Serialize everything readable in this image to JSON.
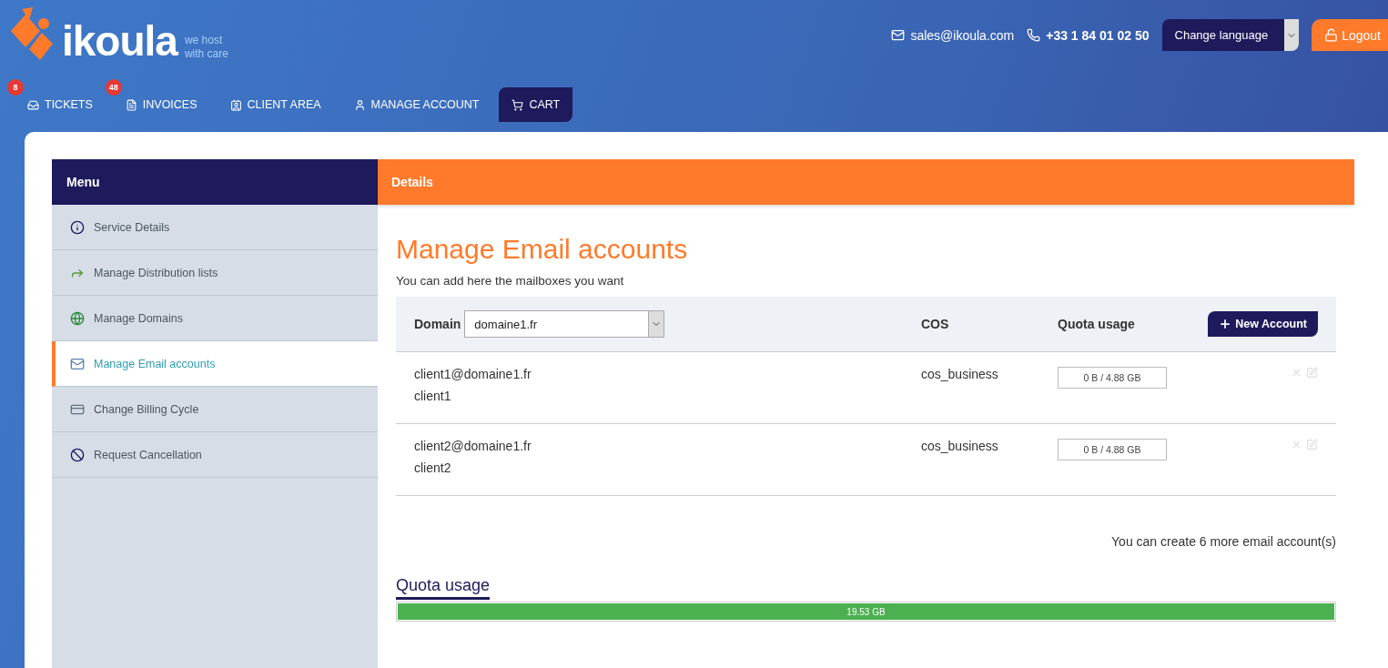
{
  "logo": {
    "name": "ikoula",
    "tagline_1": "we host",
    "tagline_2": "with care"
  },
  "contact": {
    "email": "sales@ikoula.com",
    "phone": "+33 1 84 01 02 50"
  },
  "language": {
    "label": "Change language"
  },
  "logout": {
    "label": "Logout"
  },
  "nav": [
    {
      "label": "TICKETS",
      "kind": "tickets",
      "badge": "8",
      "selected": false
    },
    {
      "label": "INVOICES",
      "kind": "invoices",
      "badge": "48",
      "selected": false
    },
    {
      "label": "CLIENT AREA",
      "kind": "client",
      "selected": false
    },
    {
      "label": "MANAGE ACCOUNT",
      "kind": "account",
      "selected": false
    },
    {
      "label": "CART",
      "kind": "cart",
      "selected": true
    }
  ],
  "menu": {
    "title": "Menu",
    "items": [
      {
        "label": "Service Details",
        "kind": "info",
        "selected": false
      },
      {
        "label": "Manage Distribution lists",
        "kind": "distribution",
        "selected": false
      },
      {
        "label": "Manage Domains",
        "kind": "globe",
        "selected": false
      },
      {
        "label": "Manage Email accounts",
        "kind": "mail",
        "selected": true
      },
      {
        "label": "Change Billing Cycle",
        "kind": "billing",
        "selected": false
      },
      {
        "label": "Request Cancellation",
        "kind": "cancel",
        "selected": false
      }
    ]
  },
  "details": {
    "title": "Details",
    "heading": "Manage Email accounts",
    "subtitle": "You can add here the mailboxes you want",
    "domain_label": "Domain",
    "domain_value": "domaine1.fr",
    "cos_header": "COS",
    "quota_header": "Quota usage",
    "new_account": "New Account",
    "accounts": [
      {
        "email": "client1@domaine1.fr",
        "name": "client1",
        "cos": "cos_business",
        "quota": "0 B / 4.88 GB"
      },
      {
        "email": "client2@domaine1.fr",
        "name": "client2",
        "cos": "cos_business",
        "quota": "0 B / 4.88 GB"
      }
    ],
    "remaining": "You can create 6 more email account(s)",
    "quota_title": "Quota usage",
    "quota_total": "19.53 GB",
    "level": 1
  }
}
